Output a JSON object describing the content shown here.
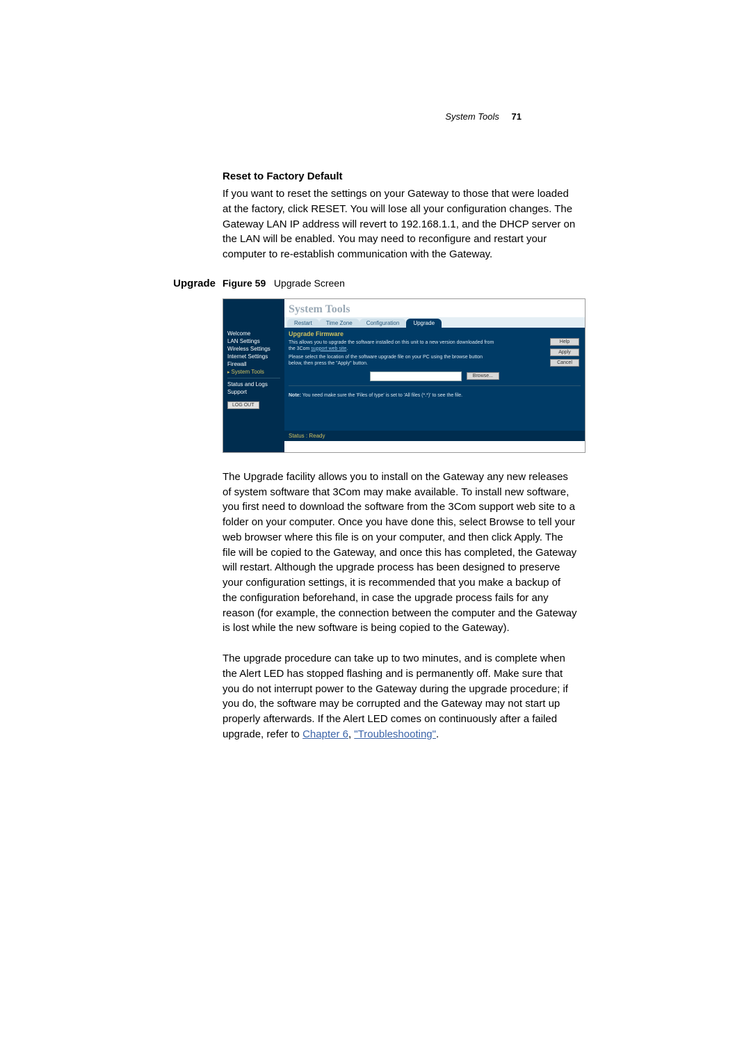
{
  "header": {
    "section": "System Tools",
    "page": "71"
  },
  "reset": {
    "heading": "Reset to Factory Default",
    "body": "If you want to reset the settings on your Gateway to those that were loaded at the factory, click RESET. You will lose all your configuration changes. The Gateway LAN IP address will revert to 192.168.1.1, and the DHCP server on the LAN will be enabled. You may need to reconfigure and restart your computer to re-establish communication with the Gateway."
  },
  "upgrade": {
    "label": "Upgrade",
    "figure_label": "Figure 59",
    "figure_title": "Upgrade Screen",
    "para1": "The Upgrade facility allows you to install on the Gateway any new releases of system software that 3Com may make available. To install new software, you first need to download the software from the 3Com support web site to a folder on your computer. Once you have done this, select Browse to tell your web browser where this file is on your computer, and then click Apply. The file will be copied to the Gateway, and once this has completed, the Gateway will restart. Although the upgrade process has been designed to preserve your configuration settings, it is recommended that you make a backup of the configuration beforehand, in case the upgrade process fails for any reason (for example, the connection between the computer and the Gateway is lost while the new software is being copied to the Gateway).",
    "para2_a": "The upgrade procedure can take up to two minutes, and is complete when the Alert LED has stopped flashing and is permanently off. Make sure that you do not interrupt power to the Gateway during the upgrade procedure; if you do, the software may be corrupted and the Gateway may not start up properly afterwards. If the Alert LED comes on continuously after a failed upgrade, refer to ",
    "para2_link1": "Chapter 6",
    "para2_mid": ", ",
    "para2_link2": "\"Troubleshooting\"",
    "para2_end": "."
  },
  "shot": {
    "title": "System Tools",
    "tabs": [
      "Restart",
      "Time Zone",
      "Configuration",
      "Upgrade"
    ],
    "nav": [
      "Welcome",
      "LAN Settings",
      "Wireless Settings",
      "Internet Settings",
      "Firewall",
      "System Tools",
      "Status and Logs",
      "Support"
    ],
    "logout": "LOG OUT",
    "section": "Upgrade Firmware",
    "line1a": "This allows you to upgrade the software installed on this unit to a new version downloaded from the 3Com ",
    "line1b": "support web site",
    "line1c": ".",
    "line2": "Please select the location of the software upgrade file on your PC using the browse button below, then press the \"Apply\" button.",
    "browse": "Browse...",
    "note_label": "Note:",
    "note": " You need make sure the 'Files of type' is set to 'All files (*.*)' to see the file.",
    "btn_help": "Help",
    "btn_apply": "Apply",
    "btn_cancel": "Cancel",
    "status": "Status : Ready"
  }
}
